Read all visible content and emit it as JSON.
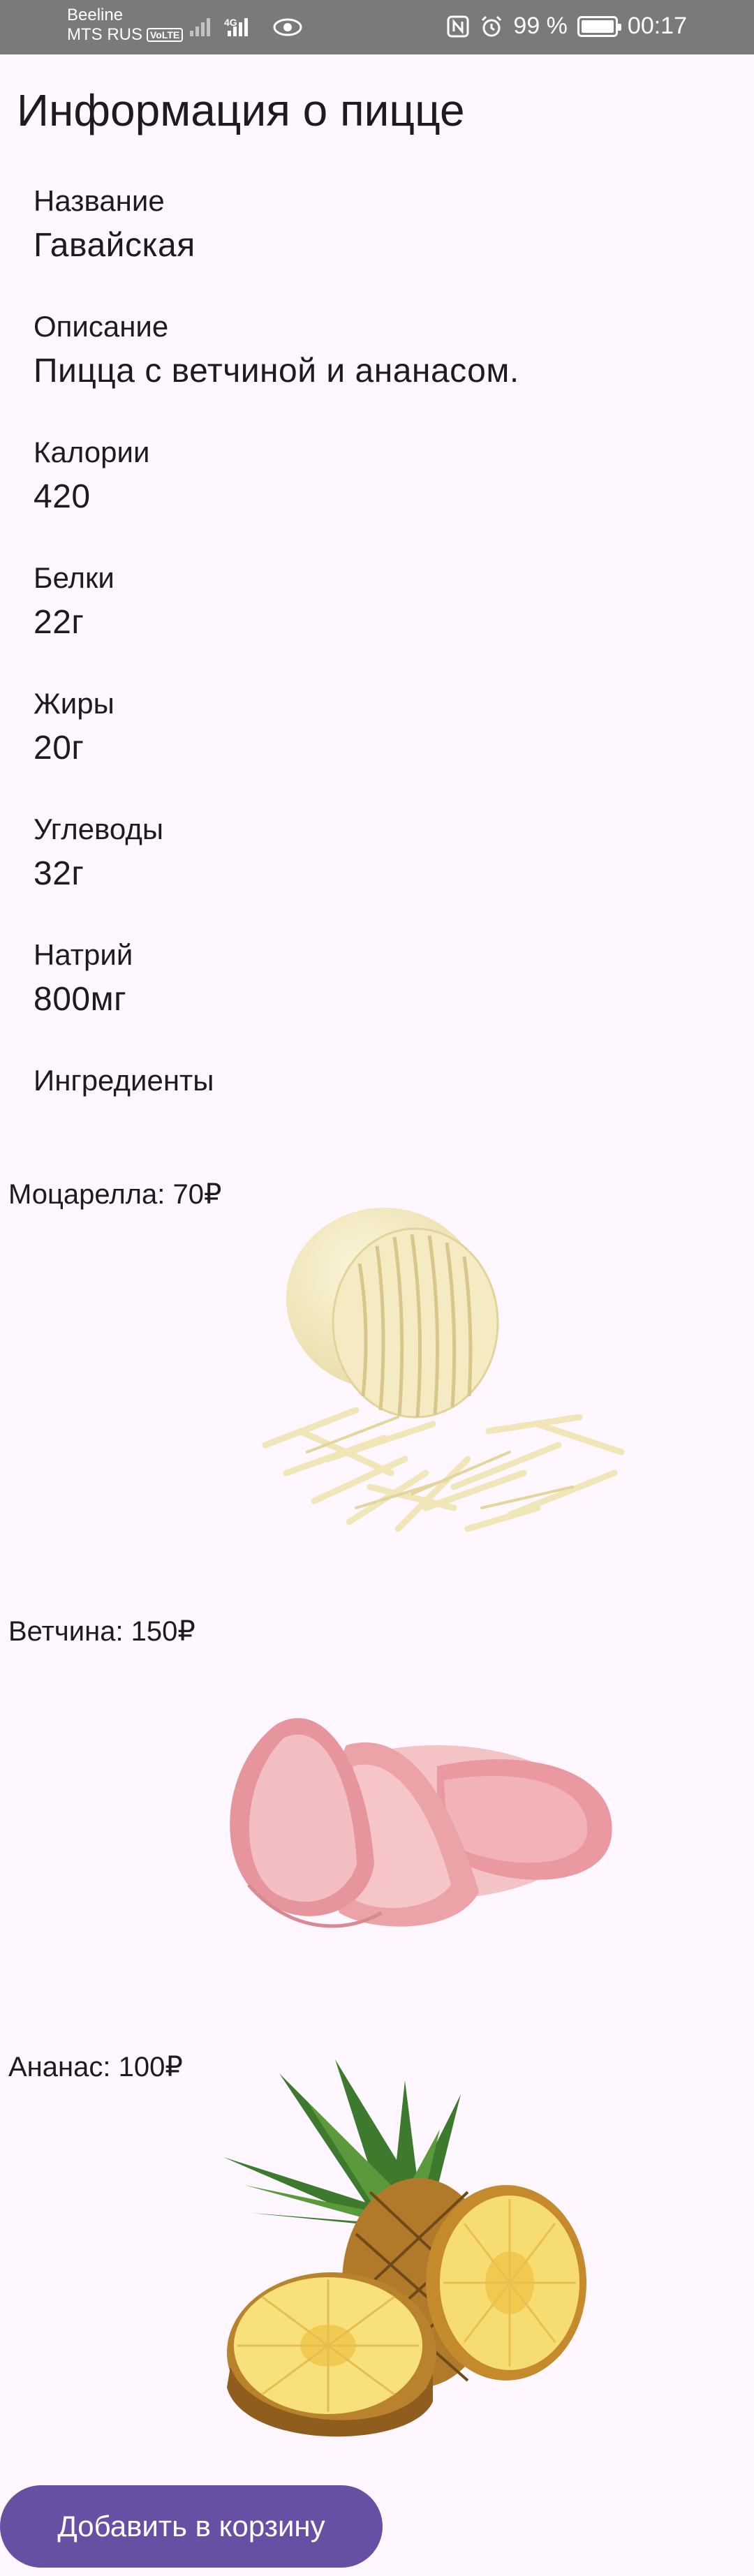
{
  "status_bar": {
    "carrier_top": "Beeline",
    "carrier_bottom": "MTS RUS",
    "volte": "VoLTE",
    "network": "4G",
    "battery": "99 %",
    "time": "00:17"
  },
  "page": {
    "title": "Информация о пицце"
  },
  "fields": {
    "name": {
      "label": "Название",
      "value": "Гавайская"
    },
    "description": {
      "label": "Описание",
      "value": "Пицца с ветчиной и ананасом."
    },
    "calories": {
      "label": "Калории",
      "value": "420"
    },
    "proteins": {
      "label": "Белки",
      "value": "22г"
    },
    "fats": {
      "label": "Жиры",
      "value": "20г"
    },
    "carbs": {
      "label": "Углеводы",
      "value": "32г"
    },
    "sodium": {
      "label": "Натрий",
      "value": "800мг"
    },
    "ingredients": {
      "label": "Ингредиенты"
    }
  },
  "ingredients": [
    {
      "caption": "Моцарелла: 70₽",
      "image": "mozzarella-image"
    },
    {
      "caption": "Ветчина: 150₽",
      "image": "ham-image"
    },
    {
      "caption": "Ананас: 100₽",
      "image": "pineapple-image"
    }
  ],
  "actions": {
    "add_to_cart": "Добавить в корзину"
  },
  "colors": {
    "background": "#FEF7FF",
    "status_bar": "#7A7A7A",
    "primary": "#6750A4",
    "on_primary": "#FFFFFF"
  }
}
